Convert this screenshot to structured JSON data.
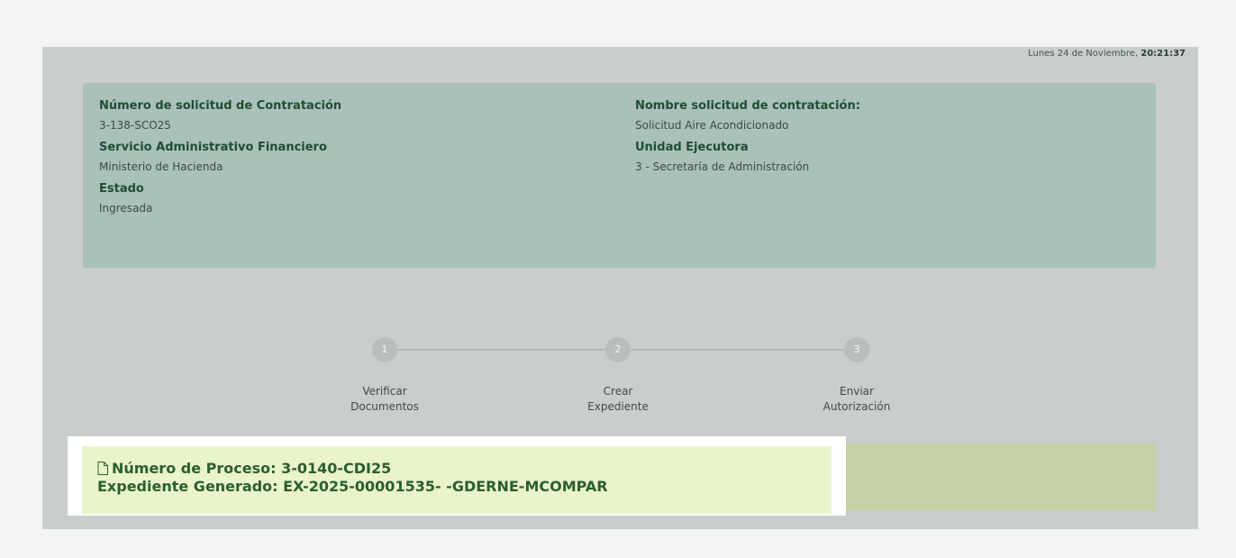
{
  "header": {
    "date": "Lunes 24 de Noviembre,",
    "time": "20:21:37"
  },
  "info": {
    "left": [
      {
        "label": "Número de solicitud de Contratación",
        "value": "3-138-SCO25"
      },
      {
        "label": "Servicio Administrativo Financiero",
        "value": "Ministerio de Hacienda"
      },
      {
        "label": "Estado",
        "value": "Ingresada"
      }
    ],
    "right": [
      {
        "label": "Nombre solicitud de contratación:",
        "value": "Solicitud Aire Acondicionado"
      },
      {
        "label": "Unidad Ejecutora",
        "value": "3 - Secretaría de Administración"
      }
    ]
  },
  "steps": [
    {
      "number": "1",
      "line1": "Verificar",
      "line2": "Documentos"
    },
    {
      "number": "2",
      "line1": "Crear",
      "line2": "Expediente"
    },
    {
      "number": "3",
      "line1": "Enviar",
      "line2": "Autorización"
    }
  ],
  "result": {
    "icon": "document-icon",
    "process_number": "Número de Proceso: 3-0140-CDI25",
    "expediente": "Expediente Generado: EX-2025-00001535- -GDERNE-MCOMPAR"
  },
  "colors": {
    "accent_green": "#2b5e2b",
    "highlight_bg": "#eaf4cc"
  }
}
